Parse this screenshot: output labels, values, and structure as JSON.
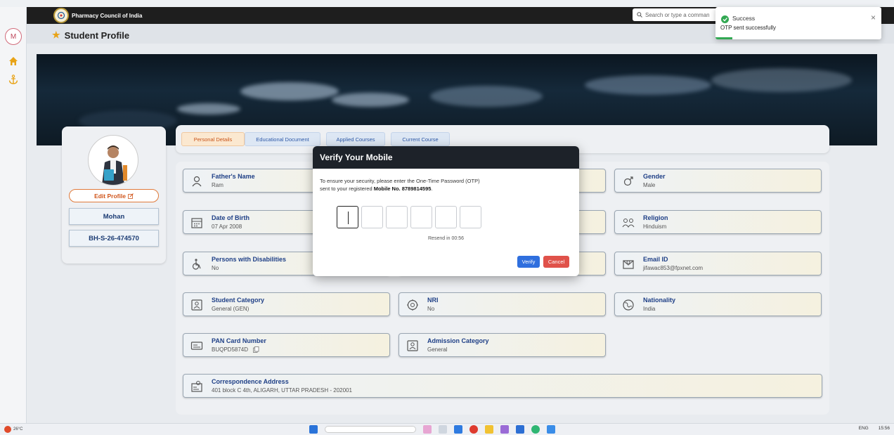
{
  "header": {
    "org_name": "Pharmacy Council of India",
    "search_placeholder": "Search or type a comman"
  },
  "sidebar": {
    "avatar_letter": "M",
    "items": [
      {
        "icon": "home-icon"
      },
      {
        "icon": "anchor-icon"
      }
    ]
  },
  "page": {
    "title": "Student Profile"
  },
  "profile": {
    "edit_label": "Edit Profile",
    "name": "Mohan",
    "registration_id": "BH-S-26-474570"
  },
  "tabs": [
    {
      "label": "Personal Details",
      "active": true
    },
    {
      "label": "Educational Document",
      "active": false
    },
    {
      "label": "Applied Courses",
      "active": false
    },
    {
      "label": "Current Course",
      "active": false
    }
  ],
  "fields": {
    "father_name": {
      "label": "Father's Name",
      "value": "Ram"
    },
    "gender": {
      "label": "Gender",
      "value": "Male"
    },
    "dob": {
      "label": "Date of Birth",
      "value": "07 Apr 2008"
    },
    "religion": {
      "label": "Religion",
      "value": "Hinduism"
    },
    "disabilities": {
      "label": "Persons with Disabilities",
      "value": "No"
    },
    "email": {
      "label": "Email ID",
      "value": "jifawac853@fpxnet.com"
    },
    "student_category": {
      "label": "Student Category",
      "value": "General (GEN)"
    },
    "nri": {
      "label": "NRI",
      "value": "No"
    },
    "nationality": {
      "label": "Nationality",
      "value": "India"
    },
    "pan": {
      "label": "PAN Card Number",
      "value": "BUQPD5874D"
    },
    "admission_category": {
      "label": "Admission Category",
      "value": "General"
    },
    "address": {
      "label": "Correspondence Address",
      "value": "401 block C 4th, ALIGARH, UTTAR PRADESH - 202001"
    }
  },
  "modal": {
    "title": "Verify Your Mobile",
    "text_line1": "To ensure your security, please enter the One-Time Password (OTP)",
    "text_line2_prefix": "sent to your registered ",
    "text_line2_bold": "Mobile No. 8789814595",
    "text_line2_suffix": ".",
    "otp_digits": [
      "",
      "",
      "",
      "",
      "",
      ""
    ],
    "resend_text": "Resend in 00:56",
    "verify_label": "Verify",
    "cancel_label": "Cancel"
  },
  "toast": {
    "title": "Success",
    "message": "OTP sent successfully",
    "progress_fraction": 0.1
  },
  "taskbar": {
    "temperature": "26°C",
    "language": "ENG",
    "time": "15:56"
  },
  "colors": {
    "accent_orange": "#d0541a",
    "label_blue": "#1e3f86",
    "success_green": "#32a852",
    "verify_blue": "#2f6fde",
    "cancel_red": "#e0524a"
  }
}
